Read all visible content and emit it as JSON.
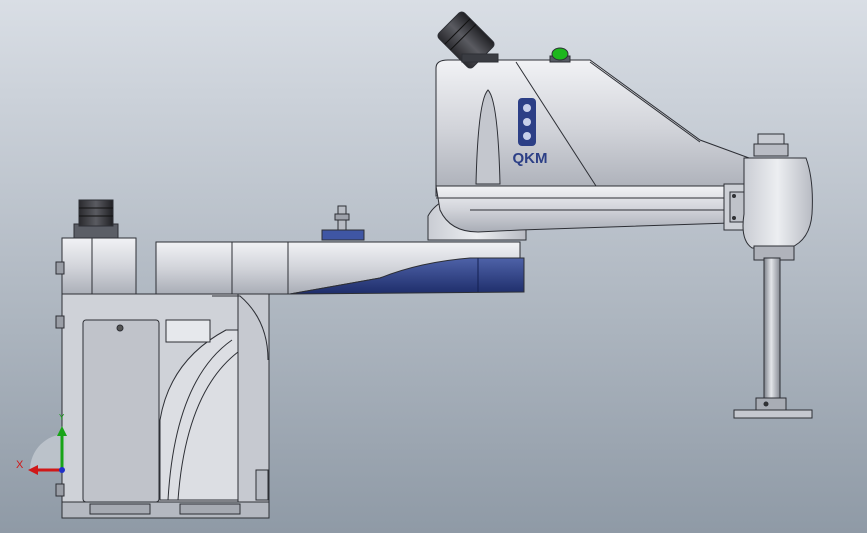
{
  "view": {
    "background_top": "#d9dee5",
    "background_bottom": "#8f9aa6"
  },
  "robot": {
    "brand": "QKM",
    "body_color": "#d4d6dc",
    "accent_color": "#2c3f86",
    "status_light_color": "#1db71d",
    "plate_label": "QKM"
  },
  "triad": {
    "x_label": "X",
    "y_label": "Y",
    "x_color": "#d01818",
    "y_color": "#18a418",
    "z_color": "#2030c8"
  }
}
